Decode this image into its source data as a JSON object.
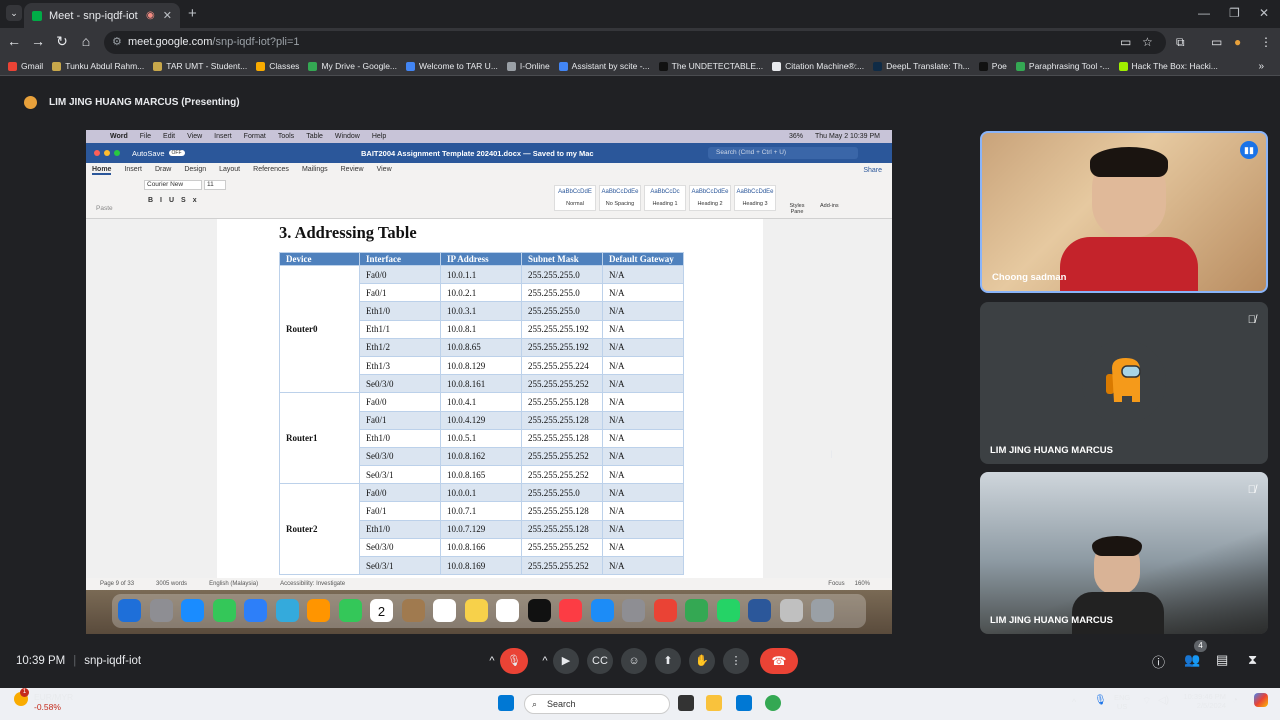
{
  "browser": {
    "tab_title": "Meet - snp-iqdf-iot",
    "url_host": "meet.google.com",
    "url_path": "/snp-iqdf-iot?pli=1",
    "bookmarks": [
      {
        "label": "Gmail",
        "color": "#ea4335"
      },
      {
        "label": "Tunku Abdul Rahm...",
        "color": "#c8a84b"
      },
      {
        "label": "TAR UMT - Student...",
        "color": "#c8a84b"
      },
      {
        "label": "Classes",
        "color": "#f9ab00"
      },
      {
        "label": "My Drive - Google...",
        "color": "#34a853"
      },
      {
        "label": "Welcome to TAR U...",
        "color": "#4285f4"
      },
      {
        "label": "I-Online",
        "color": "#9aa0a6"
      },
      {
        "label": "Assistant by scite -...",
        "color": "#4285f4"
      },
      {
        "label": "The UNDETECTABLE...",
        "color": "#111111"
      },
      {
        "label": "Citation Machine®:...",
        "color": "#e8eaed"
      },
      {
        "label": "DeepL Translate: Th...",
        "color": "#0f2b46"
      },
      {
        "label": "Poe",
        "color": "#111111"
      },
      {
        "label": "Paraphrasing Tool -...",
        "color": "#34a853"
      },
      {
        "label": "Hack The Box: Hacki...",
        "color": "#9fef00"
      }
    ]
  },
  "meet": {
    "presenting_label": "LIM JING HUANG MARCUS (Presenting)",
    "time": "10:39 PM",
    "meeting_code": "snp-iqdf-iot",
    "participant_count": "4",
    "participants": [
      {
        "name": "Choong sadman"
      },
      {
        "name": "LIM JING HUANG MARCUS"
      },
      {
        "name": "LIM JING HUANG MARCUS"
      }
    ]
  },
  "mac": {
    "menu": [
      "Word",
      "File",
      "Edit",
      "View",
      "Insert",
      "Format",
      "Tools",
      "Table",
      "Window",
      "Help"
    ],
    "battery": "36%",
    "datetime": "Thu May 2  10:39 PM"
  },
  "word": {
    "autosave": "AutoSave",
    "autosave_state": "OFF",
    "doc_title": "BAIT2004 Assignment Template 202401.docx — Saved to my Mac",
    "search_placeholder": "Search (Cmd + Ctrl + U)",
    "ribbon_tabs": [
      "Home",
      "Insert",
      "Draw",
      "Design",
      "Layout",
      "References",
      "Mailings",
      "Review",
      "View"
    ],
    "share": "Share",
    "font_name": "Courier New",
    "font_size": "11",
    "paste": "Paste",
    "styles": [
      {
        "sample": "AaBbCcDdE",
        "name": "Normal"
      },
      {
        "sample": "AaBbCcDdEe",
        "name": "No Spacing"
      },
      {
        "sample": "AaBbCcDc",
        "name": "Heading 1"
      },
      {
        "sample": "AaBbCcDdEe",
        "name": "Heading 2"
      },
      {
        "sample": "AaBbCcDdEe",
        "name": "Heading 3"
      }
    ],
    "styles_pane": "Styles Pane",
    "addins": "Add-ins",
    "status": {
      "page": "Page 9 of 33",
      "words": "3005 words",
      "language": "English (Malaysia)",
      "accessibility": "Accessibility: Investigate",
      "focus": "Focus",
      "zoom": "160%"
    }
  },
  "document": {
    "heading": "3. Addressing Table",
    "columns": [
      "Device",
      "Interface",
      "IP Address",
      "Subnet Mask",
      "Default Gateway"
    ],
    "groups": [
      {
        "device": "Router0",
        "rows": [
          [
            "Fa0/0",
            "10.0.1.1",
            "255.255.255.0",
            "N/A"
          ],
          [
            "Fa0/1",
            "10.0.2.1",
            "255.255.255.0",
            "N/A"
          ],
          [
            "Eth1/0",
            "10.0.3.1",
            "255.255.255.0",
            "N/A"
          ],
          [
            "Eth1/1",
            "10.0.8.1",
            "255.255.255.192",
            "N/A"
          ],
          [
            "Eth1/2",
            "10.0.8.65",
            "255.255.255.192",
            "N/A"
          ],
          [
            "Eth1/3",
            "10.0.8.129",
            "255.255.255.224",
            "N/A"
          ],
          [
            "Se0/3/0",
            "10.0.8.161",
            "255.255.255.252",
            "N/A"
          ]
        ]
      },
      {
        "device": "Router1",
        "rows": [
          [
            "Fa0/0",
            "10.0.4.1",
            "255.255.255.128",
            "N/A"
          ],
          [
            "Fa0/1",
            "10.0.4.129",
            "255.255.255.128",
            "N/A"
          ],
          [
            "Eth1/0",
            "10.0.5.1",
            "255.255.255.128",
            "N/A"
          ],
          [
            "Se0/3/0",
            "10.0.8.162",
            "255.255.255.252",
            "N/A"
          ],
          [
            "Se0/3/1",
            "10.0.8.165",
            "255.255.255.252",
            "N/A"
          ]
        ]
      },
      {
        "device": "Router2",
        "rows": [
          [
            "Fa0/0",
            "10.0.0.1",
            "255.255.255.0",
            "N/A"
          ],
          [
            "Fa0/1",
            "10.0.7.1",
            "255.255.255.128",
            "N/A"
          ],
          [
            "Eth1/0",
            "10.0.7.129",
            "255.255.255.128",
            "N/A"
          ],
          [
            "Se0/3/0",
            "10.0.8.166",
            "255.255.255.252",
            "N/A"
          ],
          [
            "Se0/3/1",
            "10.0.8.169",
            "255.255.255.252",
            "N/A"
          ]
        ]
      }
    ]
  },
  "dock": {
    "calendar_day": "2",
    "app_colors": [
      "#1e6fd9",
      "#8e8e93",
      "#1a8cff",
      "#34c759",
      "#2d7ff9",
      "#34aadc",
      "#ff9500",
      "#34c759",
      "#ffffff",
      "#a07a4f",
      "#ffffff",
      "#f7d14a",
      "#ffffff",
      "#111111",
      "#fc3c44",
      "#1c8cf7",
      "#8e8e93",
      "#ea4335",
      "#34a853",
      "#25d366",
      "#2b579a",
      "#c0c0c0",
      "#9aa0a6"
    ]
  },
  "taskbar": {
    "ticker_pair": "EUR/MYR",
    "ticker_change": "-0.58%",
    "ticker_badge": "1",
    "search": "Search",
    "lang": "ENG",
    "region": "US",
    "time": "10:39:46 PM",
    "date": "2/5/2024"
  },
  "colors": {
    "accent": "#8ab4f8",
    "end_call": "#ea4335",
    "word_blue": "#2b579a",
    "table_header": "#4f81bd",
    "table_band": "#dbe5f1"
  }
}
